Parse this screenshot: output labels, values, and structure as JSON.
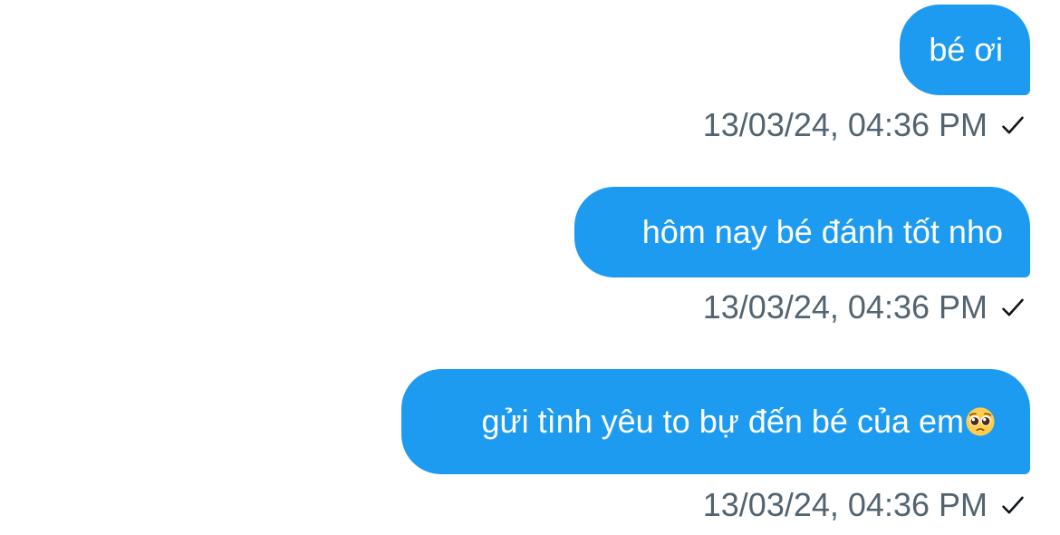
{
  "messages": [
    {
      "text": "bé ơi",
      "timestamp": "13/03/24, 04:36 PM",
      "status_icon": "check-icon"
    },
    {
      "text": "hôm nay bé đánh tốt nho",
      "timestamp": "13/03/24, 04:36 PM",
      "status_icon": "check-icon"
    },
    {
      "text": "gửi tình yêu to bự đến bé của em",
      "emoji": "pleading-face-emoji",
      "timestamp": "13/03/24, 04:36 PM",
      "status_icon": "check-icon"
    }
  ],
  "colors": {
    "bubble": "#1d9bf0",
    "bubble_text": "#ffffff",
    "meta_text": "#536471",
    "check": "#0f1419"
  }
}
